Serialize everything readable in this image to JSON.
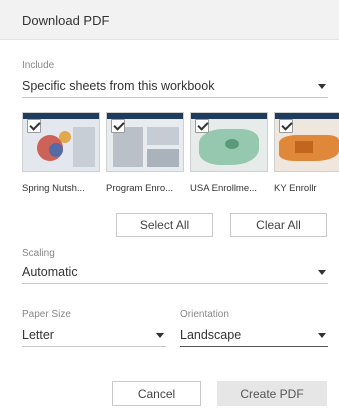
{
  "dialog": {
    "title": "Download PDF"
  },
  "include": {
    "label": "Include",
    "value": "Specific sheets from this workbook",
    "icon": "chevron-down-icon"
  },
  "sheets": [
    {
      "caption": "Spring Nutsh...",
      "checked": true,
      "thumb_color": "#d35a4a"
    },
    {
      "caption": "Program Enro...",
      "checked": true,
      "thumb_color": "#9aa3ad"
    },
    {
      "caption": "USA Enrollme...",
      "checked": true,
      "thumb_color": "#7fb89a"
    },
    {
      "caption": "KY Enrollr",
      "checked": true,
      "thumb_color": "#e0883a"
    }
  ],
  "actions": {
    "select_all": "Select All",
    "clear_all": "Clear All"
  },
  "scaling": {
    "label": "Scaling",
    "value": "Automatic"
  },
  "paper_size": {
    "label": "Paper Size",
    "value": "Letter"
  },
  "orientation": {
    "label": "Orientation",
    "value": "Landscape"
  },
  "footer": {
    "cancel": "Cancel",
    "create": "Create PDF"
  },
  "colors": {
    "header_bg": "#f2f2f2",
    "primary_button_bg": "#e6e6e6",
    "thumb_bar": "#1f3b5e"
  }
}
